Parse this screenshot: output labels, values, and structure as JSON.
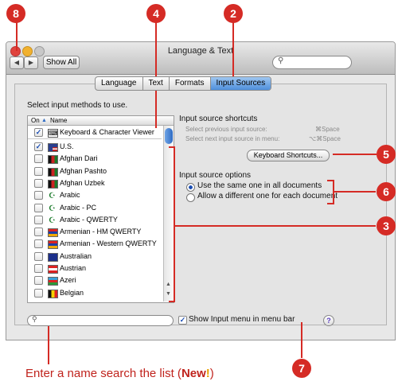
{
  "window": {
    "title": "Language & Text",
    "show_all": "Show All",
    "tabs": [
      {
        "label": "Language",
        "active": false
      },
      {
        "label": "Text",
        "active": false
      },
      {
        "label": "Formats",
        "active": false
      },
      {
        "label": "Input Sources",
        "active": true
      }
    ]
  },
  "input_methods": {
    "heading": "Select input methods to use.",
    "col_on": "On",
    "col_name": "Name",
    "rows": [
      {
        "label": "Keyboard & Character Viewer",
        "checked": true,
        "flag": "keyboard"
      },
      {
        "label": "U.S.",
        "checked": true,
        "flag": "us"
      },
      {
        "label": "Afghan Dari",
        "checked": false,
        "flag": "afghan"
      },
      {
        "label": "Afghan Pashto",
        "checked": false,
        "flag": "afghan"
      },
      {
        "label": "Afghan Uzbek",
        "checked": false,
        "flag": "afghan"
      },
      {
        "label": "Arabic",
        "checked": false,
        "flag": "crescent"
      },
      {
        "label": "Arabic - PC",
        "checked": false,
        "flag": "crescent"
      },
      {
        "label": "Arabic - QWERTY",
        "checked": false,
        "flag": "crescent"
      },
      {
        "label": "Armenian - HM QWERTY",
        "checked": false,
        "flag": "armenian"
      },
      {
        "label": "Armenian - Western QWERTY",
        "checked": false,
        "flag": "armenian"
      },
      {
        "label": "Australian",
        "checked": false,
        "flag": "australian"
      },
      {
        "label": "Austrian",
        "checked": false,
        "flag": "austrian"
      },
      {
        "label": "Azeri",
        "checked": false,
        "flag": "azeri"
      },
      {
        "label": "Belgian",
        "checked": false,
        "flag": "belgian"
      }
    ]
  },
  "shortcuts": {
    "heading": "Input source shortcuts",
    "prev_label": "Select previous input source:",
    "prev_key": "⌘Space",
    "next_label": "Select next input source in menu:",
    "next_key": "⌥⌘Space",
    "button": "Keyboard Shortcuts..."
  },
  "options": {
    "heading": "Input source options",
    "same": "Use the same one in all documents",
    "different": "Allow a different one for each document",
    "selected": "same"
  },
  "bottom": {
    "show_menu": "Show Input menu in menu bar",
    "show_menu_checked": true,
    "help": "?"
  },
  "callouts": [
    "8",
    "4",
    "2",
    "5",
    "6",
    "3",
    "7"
  ],
  "caption": {
    "text": "Enter a name search the list (",
    "new_word": "New",
    "bang": "!",
    "close": ")"
  },
  "colors": {
    "callout": "#d52b25",
    "accent": "#2f6cc4"
  }
}
